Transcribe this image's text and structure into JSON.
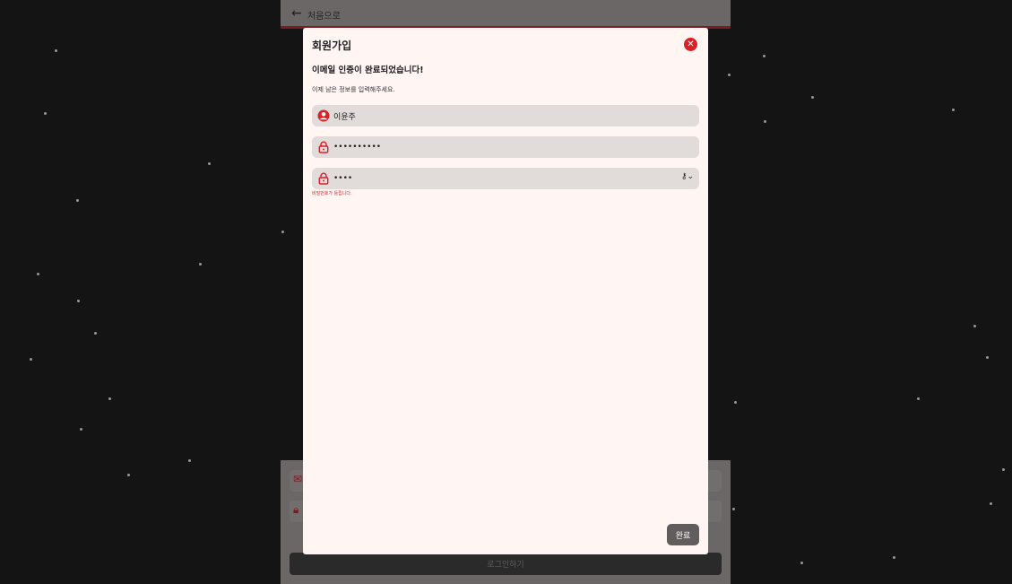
{
  "background": {
    "back_label": "처음으로",
    "login_label": "로그인하기"
  },
  "modal": {
    "title": "회원가입",
    "heading": "이메일 인증이 완료되었습니다!",
    "description": "이제 남은 정보를 입력해주세요.",
    "fields": {
      "name_value": "이윤주",
      "password_value": "••••••••••",
      "confirm_value": "••••"
    },
    "error_text": "비밀번호가 틀립니다.",
    "done_label": "완료"
  },
  "colors": {
    "accent": "#dd1f26",
    "field_bg": "#e1dbda",
    "modal_bg": "#fff6f4"
  }
}
